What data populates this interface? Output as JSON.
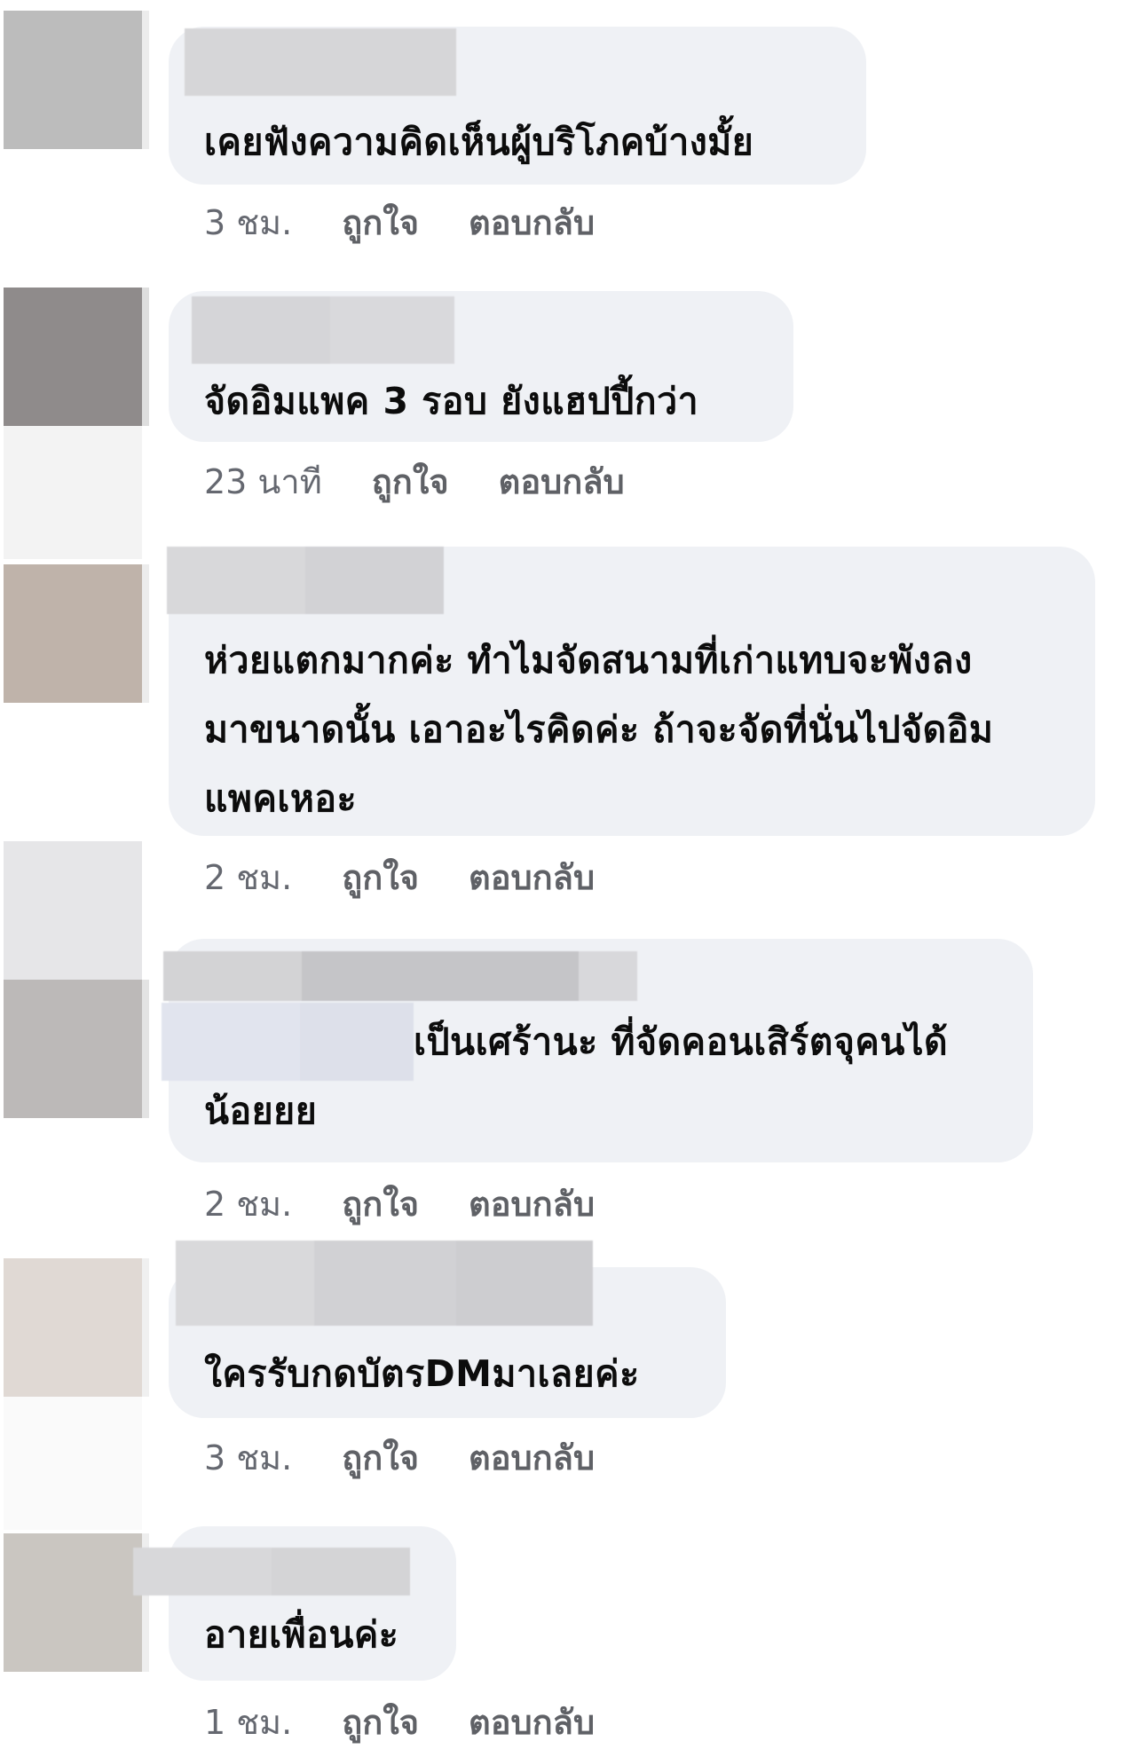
{
  "comments": [
    {
      "text": "เคยฟังความคิดเห็นผู้บริโภคบ้างมั้ย",
      "time": "3 ชม.",
      "like_label": "ถูกใจ",
      "reply_label": "ตอบกลับ",
      "avatar_color": "#bcbcbc"
    },
    {
      "text": "จัดอิมแพค 3 รอบ ยังแฮปปี้กว่า",
      "time": "23 นาที",
      "like_label": "ถูกใจ",
      "reply_label": "ตอบกลับ",
      "avatar_color": "#8f8b8b"
    },
    {
      "text": "ห่วยแตกมากค่ะ ทำไมจัดสนามที่เก่าแทบจะพังลงมาขนาดนั้น เอาอะไรคิดค่ะ ถ้าจะจัดที่นั่นไปจัดอิมแพคเหอะ",
      "line1": "ห่วยแตกมากค่ะ ทำไมจัดสนามที่เก่าแทบจะพังลง",
      "line2": "มาขนาดนั้น เอาอะไรคิดค่ะ ถ้าจะจัดที่นั่นไปจัดอิม",
      "line3": "แพคเหอะ",
      "time": "2 ชม.",
      "like_label": "ถูกใจ",
      "reply_label": "ตอบกลับ",
      "avatar_color": "#bfb3aa"
    },
    {
      "text": "เป็นเศร้านะ ที่จัดคอนเสิร์ตจุคนได้น้อยยย",
      "line1": "เป็นเศร้านะ ที่จัดคอนเสิร์ตจุคนได้",
      "line2": "น้อยยย",
      "time": "2 ชม.",
      "like_label": "ถูกใจ",
      "reply_label": "ตอบกลับ",
      "avatar_color": "#bcb9b8"
    },
    {
      "text": "ใครรับกดบัตรDMมาเลยค่ะ",
      "time": "3 ชม.",
      "like_label": "ถูกใจ",
      "reply_label": "ตอบกลับ",
      "avatar_color": "#e0d9d4"
    },
    {
      "text": "อายเพื่อนค่ะ",
      "time": "1 ชม.",
      "like_label": "ถูกใจ",
      "reply_label": "ตอบกลับ",
      "avatar_color": "#cac6c1"
    }
  ],
  "colors": {
    "bubble": "#eff1f5",
    "meta_text": "#65676b",
    "blur_gray": "#d3d3d6"
  }
}
